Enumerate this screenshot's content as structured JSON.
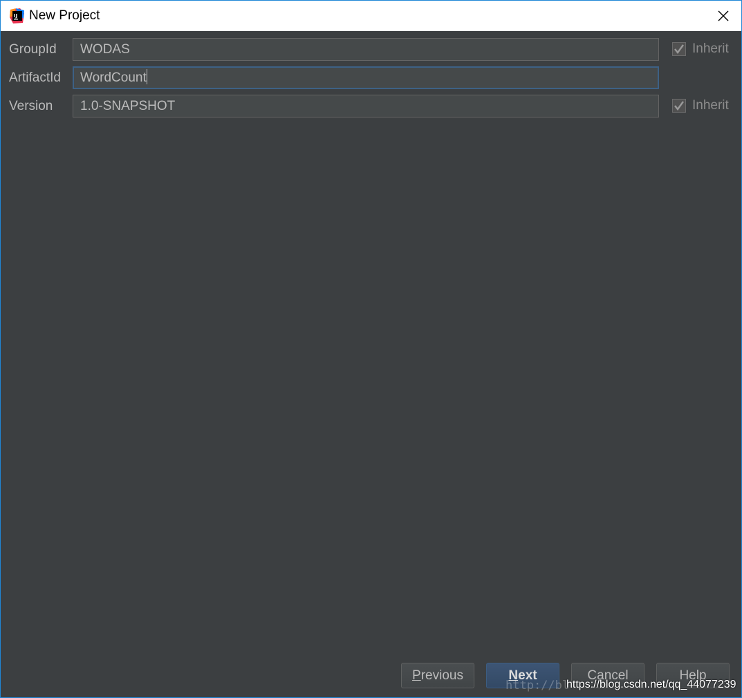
{
  "window": {
    "title": "New Project",
    "app_icon": "intellij-idea-icon",
    "close_icon": "close-icon"
  },
  "form": {
    "group_id": {
      "label": "GroupId",
      "value": "WODAS",
      "inherit": {
        "label": "Inherit",
        "checked": true
      }
    },
    "artifact_id": {
      "label": "ArtifactId",
      "value": "WordCount"
    },
    "version": {
      "label": "Version",
      "value": "1.0-SNAPSHOT",
      "inherit": {
        "label": "Inherit",
        "checked": true
      }
    }
  },
  "buttons": {
    "previous": {
      "mnemonic": "P",
      "rest": "revious"
    },
    "next": {
      "mnemonic": "N",
      "rest": "ext"
    },
    "cancel": "Cancel",
    "help": "Help"
  },
  "watermark": {
    "faint": "http://bl",
    "text": "https://blog.csdn.net/qq_44077239"
  },
  "colors": {
    "background": "#3c3f41",
    "field_background": "#45494a",
    "focus_border": "#3d6185",
    "primary_button": "#365880",
    "label_text": "#bbbbbb"
  }
}
